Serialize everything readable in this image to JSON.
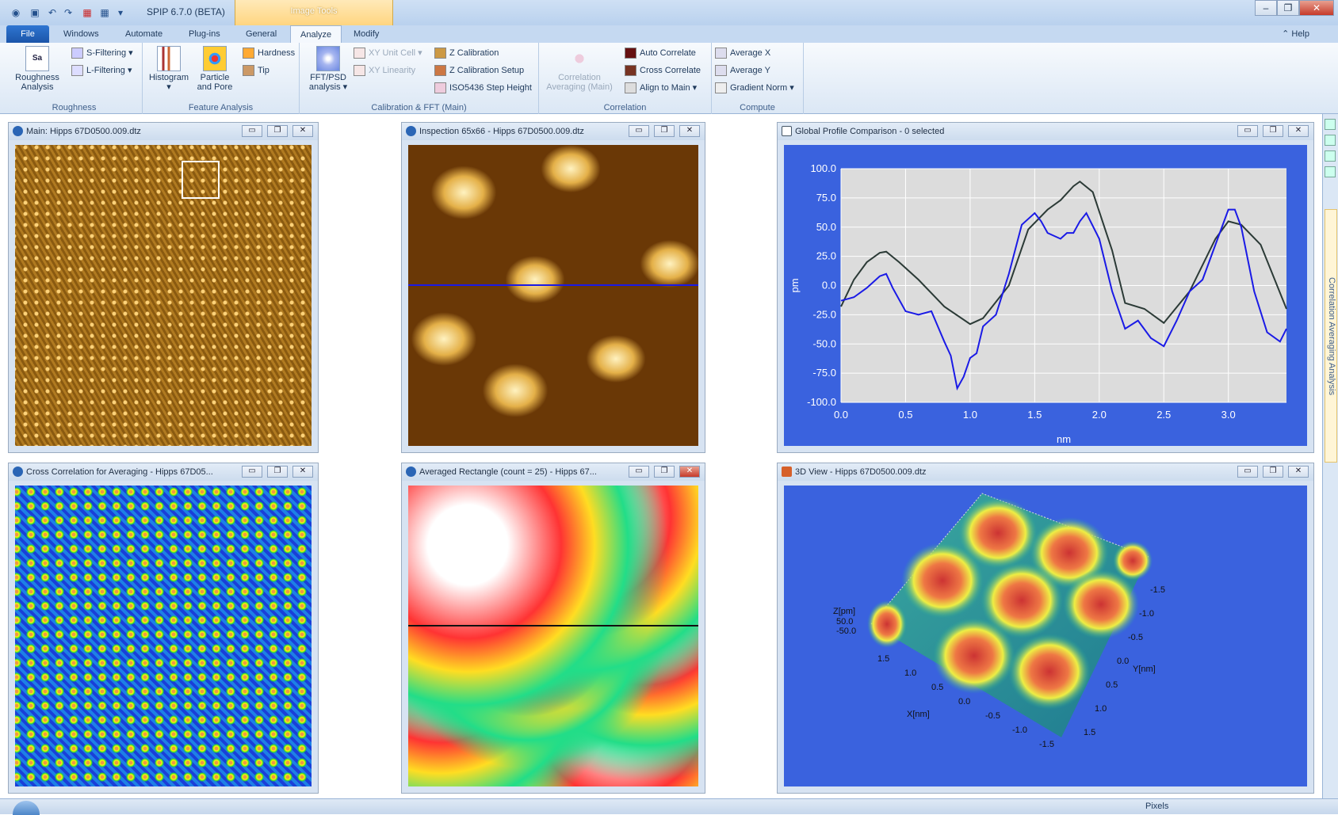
{
  "app": {
    "title": "SPIP 6.7.0 (BETA)",
    "context_tab": "Image Tools"
  },
  "tabs": [
    "File",
    "Windows",
    "Automate",
    "Plug-ins",
    "General",
    "Analyze",
    "Modify"
  ],
  "help": "Help",
  "ribbon": {
    "roughness": {
      "label": "Roughness",
      "big": "Roughness Analysis",
      "big_icon": "Sa",
      "s_filtering": "S-Filtering",
      "l_filtering": "L-Filtering"
    },
    "feature": {
      "label": "Feature Analysis",
      "histogram": "Histogram",
      "particle": "Particle and Pore",
      "hardness": "Hardness",
      "tip": "Tip"
    },
    "calib": {
      "label": "Calibration & FFT (Main)",
      "fft": "FFT/PSD analysis",
      "xy_unit": "XY Unit Cell",
      "xy_lin": "XY Linearity",
      "z_cal": "Z Calibration",
      "z_cal_setup": "Z Calibration Setup",
      "iso": "ISO5436 Step Height"
    },
    "correlation": {
      "label": "Correlation",
      "averaging": "Correlation Averaging (Main)",
      "auto": "Auto Correlate",
      "cross": "Cross Correlate",
      "align": "Align to Main"
    },
    "compute": {
      "label": "Compute",
      "avg_x": "Average X",
      "avg_y": "Average Y",
      "grad": "Gradient Norm"
    }
  },
  "windows": {
    "main": "Main: Hipps 67D0500.009.dtz",
    "inspection": "Inspection 65x66 - Hipps 67D0500.009.dtz",
    "profile": "Global Profile Comparison - 0 selected",
    "crosscorr": "Cross Correlation for Averaging - Hipps 67D05...",
    "averaged": "Averaged Rectangle (count = 25) - Hipps 67...",
    "view3d": "3D View - Hipps 67D0500.009.dtz"
  },
  "view3d": {
    "zlabel": "Z[pm]",
    "z_hi": "50.0",
    "z_lo": "-50.0",
    "xlabel": "X[nm]",
    "ylabel": "Y[nm]",
    "xticks": [
      "1.5",
      "1.0",
      "0.5",
      "0.0",
      "-0.5",
      "-1.0",
      "-1.5"
    ],
    "yticks": [
      "-1.5",
      "-1.0",
      "-0.5",
      "0.0",
      "0.5",
      "1.0",
      "1.5"
    ]
  },
  "side_pane": "Correlation Averaging Analysis",
  "status": {
    "pixels": "Pixels"
  },
  "colors": {
    "plot_bg": "#3a62de",
    "chart_area": "#dcdcdc",
    "series_blue": "#1a1ae6",
    "series_dark": "#2b3a36"
  },
  "chart_data": {
    "type": "line",
    "xlabel": "nm",
    "ylabel": "pm",
    "xlim": [
      0,
      3.45
    ],
    "ylim": [
      -100,
      100
    ],
    "xticks": [
      "0.0",
      "0.5",
      "1.0",
      "1.5",
      "2.0",
      "2.5",
      "3.0"
    ],
    "yticks": [
      "100.0",
      "75.0",
      "50.0",
      "25.0",
      "0.0",
      "-25.0",
      "-50.0",
      "-75.0",
      "-100.0"
    ],
    "grid": true,
    "series": [
      {
        "color": "#2b3a36",
        "x": [
          0,
          0.1,
          0.2,
          0.3,
          0.35,
          0.45,
          0.6,
          0.8,
          1.0,
          1.1,
          1.3,
          1.45,
          1.6,
          1.7,
          1.8,
          1.85,
          1.95,
          2.1,
          2.2,
          2.35,
          2.5,
          2.7,
          2.9,
          3.0,
          3.1,
          3.25,
          3.45
        ],
        "y": [
          -18,
          5,
          20,
          28,
          29,
          20,
          5,
          -18,
          -33,
          -28,
          0,
          48,
          65,
          73,
          85,
          89,
          80,
          30,
          -15,
          -20,
          -32,
          -5,
          40,
          55,
          52,
          35,
          -20
        ]
      },
      {
        "color": "#1a1ae6",
        "x": [
          0,
          0.1,
          0.2,
          0.3,
          0.35,
          0.4,
          0.5,
          0.6,
          0.7,
          0.75,
          0.8,
          0.85,
          0.9,
          0.95,
          1.0,
          1.05,
          1.1,
          1.2,
          1.3,
          1.4,
          1.5,
          1.55,
          1.6,
          1.7,
          1.75,
          1.8,
          1.85,
          1.9,
          2.0,
          2.1,
          2.2,
          2.3,
          2.4,
          2.5,
          2.6,
          2.7,
          2.8,
          2.9,
          3.0,
          3.05,
          3.1,
          3.2,
          3.3,
          3.4,
          3.45
        ],
        "y": [
          -13,
          -10,
          -2,
          8,
          10,
          -2,
          -22,
          -25,
          -22,
          -35,
          -48,
          -60,
          -88,
          -78,
          -62,
          -58,
          -35,
          -25,
          10,
          52,
          62,
          55,
          45,
          40,
          45,
          45,
          55,
          62,
          40,
          -5,
          -37,
          -30,
          -45,
          -52,
          -30,
          -5,
          5,
          35,
          65,
          65,
          50,
          -5,
          -40,
          -48,
          -37
        ]
      }
    ]
  }
}
